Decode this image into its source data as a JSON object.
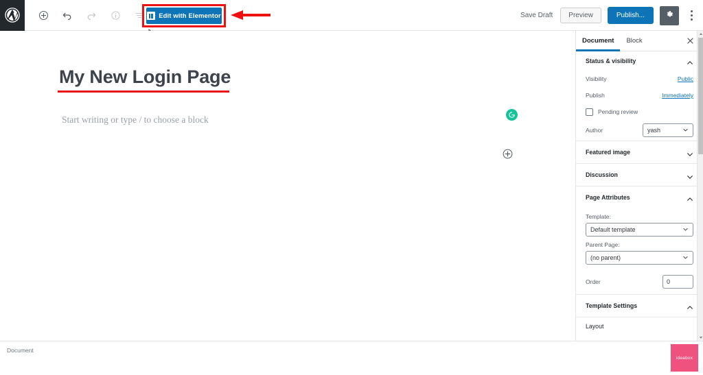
{
  "window": {
    "app": "WordPress Block Editor"
  },
  "topbar": {
    "logo_icon": "wordpress-logo-icon",
    "tools": [
      {
        "name": "add-block-icon",
        "label": "Add block",
        "disabled": false
      },
      {
        "name": "undo-icon",
        "label": "Undo",
        "disabled": false
      },
      {
        "name": "redo-icon",
        "label": "Redo",
        "disabled": true
      },
      {
        "name": "info-icon",
        "label": "Content structure",
        "disabled": true
      },
      {
        "name": "list-view-icon",
        "label": "Block navigation",
        "disabled": true
      },
      {
        "name": "pencil-icon",
        "label": "Edit",
        "disabled": false
      }
    ],
    "elementor_button": {
      "label": "Edit with Elementor",
      "icon": "elementor-logo-icon",
      "bg_color": "#0d74b8",
      "highlight_color": "#ee1111"
    },
    "save_draft_label": "Save Draft",
    "preview_label": "Preview",
    "publish_label": "Publish...",
    "settings_icon": "gear-icon",
    "more_menu_icon": "kebab-menu-icon"
  },
  "annotation": {
    "arrow_color": "#ee1111",
    "arrow_direction": "left",
    "title_underline_color": "#ee1111"
  },
  "editor": {
    "post_title": "My New Login Page",
    "paragraph_placeholder": "Start writing or type / to choose a block",
    "grammarly_icon": "grammarly-g-icon",
    "grammarly_color": "#15c39a",
    "add_block_icon": "plus-circle-icon"
  },
  "sidebar": {
    "tabs": [
      {
        "label": "Document",
        "active": true
      },
      {
        "label": "Block",
        "active": false
      }
    ],
    "close_icon": "close-icon",
    "sections": [
      {
        "title": "Status & visibility",
        "expanded": true,
        "chevron": "chevron-up-icon",
        "rows": [
          {
            "label": "Visibility",
            "value": "Public",
            "type": "link"
          },
          {
            "label": "Publish",
            "value": "Immediately",
            "type": "link"
          }
        ],
        "checkbox": {
          "label": "Pending review",
          "checked": false
        },
        "author": {
          "label": "Author",
          "value": "yash",
          "chevron": "chevron-down-icon"
        }
      },
      {
        "title": "Featured image",
        "expanded": false,
        "chevron": "chevron-down-icon"
      },
      {
        "title": "Discussion",
        "expanded": false,
        "chevron": "chevron-down-icon"
      },
      {
        "title": "Page Attributes",
        "expanded": true,
        "chevron": "chevron-up-icon",
        "template_label": "Template:",
        "template_value": "Default template",
        "parent_label": "Parent Page:",
        "parent_value": "(no parent)",
        "order_label": "Order",
        "order_value": "0"
      },
      {
        "title": "Template Settings",
        "expanded": true,
        "chevron": "chevron-up-icon",
        "sub_label": "Layout"
      }
    ]
  },
  "bottombar": {
    "breadcrumb": "Document",
    "widget": {
      "label": "ideabox",
      "color": "#f0527f"
    }
  }
}
